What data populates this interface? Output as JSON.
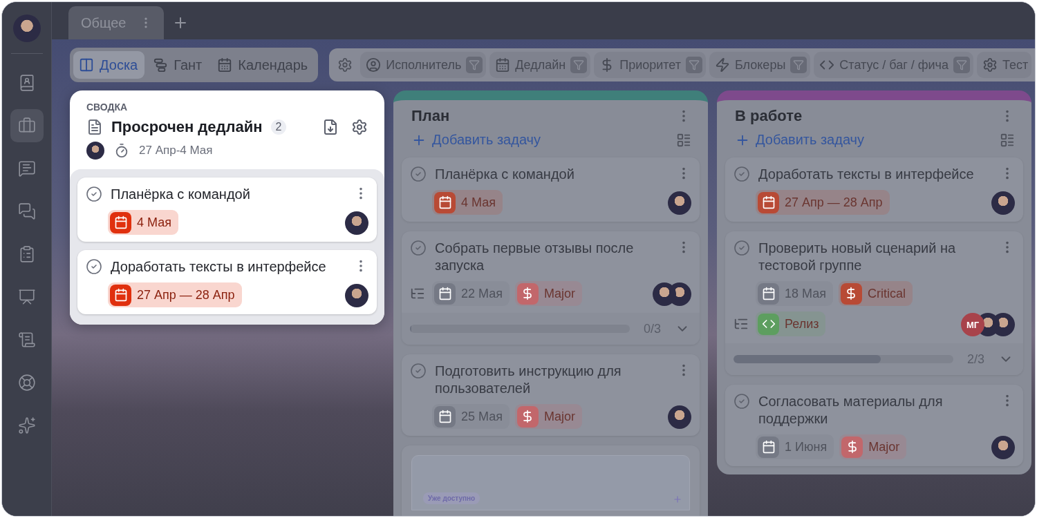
{
  "sidebar": {
    "items": [
      {
        "kind": "contacts",
        "selected": false
      },
      {
        "kind": "briefcase",
        "selected": true
      },
      {
        "kind": "chat",
        "selected": false
      },
      {
        "kind": "chats",
        "selected": false
      },
      {
        "kind": "clipboard",
        "selected": false
      },
      {
        "kind": "monitor",
        "selected": false
      },
      {
        "kind": "scroll",
        "selected": false
      },
      {
        "kind": "lifebuoy",
        "selected": false
      },
      {
        "kind": "sparkles",
        "selected": false
      }
    ]
  },
  "tabs": [
    {
      "label": "Общее",
      "selected": true
    }
  ],
  "views": [
    {
      "label": "Доска",
      "kind": "board",
      "selected": true
    },
    {
      "label": "Гант",
      "kind": "gantt",
      "selected": false
    },
    {
      "label": "Календарь",
      "kind": "calendar",
      "selected": false
    }
  ],
  "filters": [
    {
      "label": "Исполнитель",
      "kind": "user",
      "funnel": true
    },
    {
      "label": "Дедлайн",
      "kind": "calendar",
      "funnel": true
    },
    {
      "label": "Приоритет",
      "kind": "dollar",
      "funnel": true
    },
    {
      "label": "Блокеры",
      "kind": "zap",
      "funnel": true
    },
    {
      "label": "Статус / баг / фича",
      "kind": "code",
      "funnel": true
    },
    {
      "label": "Тест",
      "kind": "gear",
      "funnel": false
    }
  ],
  "summary": {
    "caption": "СВОДКА",
    "title": "Просрочен дедлайн",
    "count": "2",
    "period": "27 Апр-4 Мая",
    "tasks": [
      {
        "title": "Планёрка с командой",
        "subtasks": false,
        "tags": [
          {
            "kind": "date",
            "text": "4 Мая",
            "color": "#e0300e"
          }
        ],
        "assignees": [
          {
            "kind": "photo"
          }
        ]
      },
      {
        "title": "Доработать тексты в интерфейсе",
        "subtasks": false,
        "tags": [
          {
            "kind": "date",
            "text": "27 Апр — 28 Апр",
            "color": "#e0300e"
          }
        ],
        "assignees": [
          {
            "kind": "photo"
          }
        ]
      }
    ]
  },
  "columns": [
    {
      "title": "План",
      "color": "#3f7f7a",
      "add_label": "Добавить задачу",
      "tasks": [
        {
          "title": "Планёрка с командой",
          "subtasks": false,
          "tags": [
            {
              "kind": "date",
              "text": "4 Мая",
              "color": "#b84a35"
            }
          ],
          "assignees": [
            {
              "kind": "photo"
            }
          ]
        },
        {
          "title": "Собрать первые отзывы после запуска",
          "subtasks": true,
          "tags": [
            {
              "kind": "date",
              "text": "22 Мая",
              "color": "#757985"
            },
            {
              "kind": "priority",
              "text": "Major",
              "color": "#c2676b"
            }
          ],
          "assignees": [
            {
              "kind": "photo"
            },
            {
              "kind": "photo"
            }
          ],
          "progress": {
            "level": 0,
            "text": "0/3"
          }
        },
        {
          "title": "Подготовить инструкцию для пользователей",
          "subtasks": false,
          "tags": [
            {
              "kind": "date",
              "text": "25 Мая",
              "color": "#757985"
            },
            {
              "kind": "priority",
              "text": "Major",
              "color": "#c2676b"
            }
          ],
          "assignees": [
            {
              "kind": "photo"
            }
          ]
        },
        {
          "kind": "preview",
          "badge": "Уже доступно"
        }
      ]
    },
    {
      "title": "В работе",
      "color": "#7e4a8c",
      "add_label": "Добавить задачу",
      "tasks": [
        {
          "title": "Доработать тексты в интерфейсе",
          "subtasks": false,
          "tags": [
            {
              "kind": "date",
              "text": "27 Апр — 28 Апр",
              "color": "#b84a35"
            }
          ],
          "assignees": [
            {
              "kind": "photo"
            }
          ]
        },
        {
          "title": "Проверить новый сценарий на тестовой группе",
          "subtasks": true,
          "tags": [
            {
              "kind": "date",
              "text": "18 Мая",
              "color": "#757985"
            },
            {
              "kind": "priority",
              "text": "Critical",
              "color": "#b84a35"
            },
            {
              "kind": "status",
              "text": "Релиз",
              "color": "#5d9e5f"
            }
          ],
          "assignees": [
            {
              "kind": "initials",
              "text": "МГ"
            },
            {
              "kind": "photo"
            },
            {
              "kind": "photo"
            }
          ],
          "progress": {
            "level": 0.67,
            "text": "2/3"
          }
        },
        {
          "title": "Согласовать материалы для поддержки",
          "subtasks": false,
          "tags": [
            {
              "kind": "date",
              "text": "1 Июня",
              "color": "#757985"
            },
            {
              "kind": "priority",
              "text": "Major",
              "color": "#c2676b"
            }
          ],
          "assignees": [
            {
              "kind": "photo"
            }
          ]
        }
      ]
    }
  ]
}
